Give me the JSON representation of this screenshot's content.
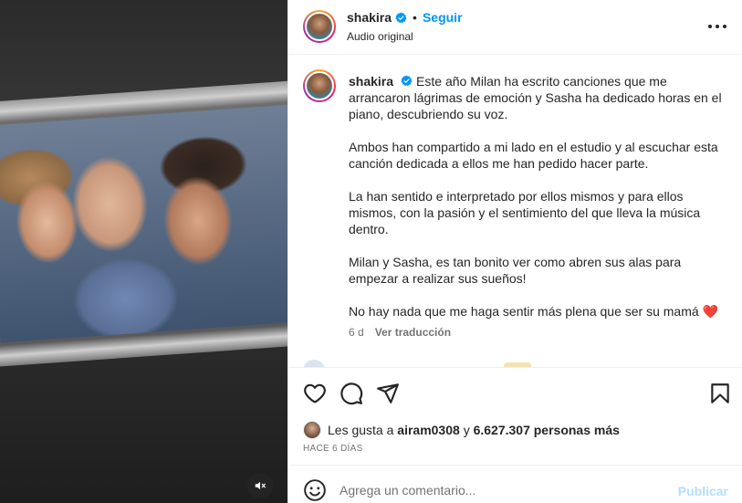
{
  "post": {
    "username": "shakira",
    "follow_label": "Seguir",
    "dot": "•",
    "audio_label": "Audio original"
  },
  "caption": {
    "username": "shakira",
    "paragraphs": [
      "Este año Milan ha escrito canciones que me arrancaron lágrimas de emoción y Sasha ha dedicado horas en el piano, descubriendo su voz.",
      "Ambos han compartido a mi lado en el estudio y al escuchar esta canción dedicada a ellos me han pedido hacer parte.",
      "La han sentido e interpretado por ellos mismos y para ellos mismos, con la pasión y el sentimiento del que lleva la música dentro.",
      "Milan y Sasha, es tan bonito ver como abren sus alas para empezar a realizar sus sueños!",
      "No hay nada que me haga sentir más plena que ser su mamá"
    ],
    "heart_emoji": "❤️",
    "age": "6 d",
    "translate_label": "Ver traducción"
  },
  "likes": {
    "prefix": "Les gusta a",
    "user": "airam0308",
    "connector": "y",
    "count": "6.627.307 personas más"
  },
  "date_label": "HACE 6 DÍAS",
  "comment": {
    "placeholder": "Agrega un comentario...",
    "publish_label": "Publicar"
  },
  "icons": [
    "verified-badge-icon",
    "more-options-icon",
    "heart-icon",
    "comment-icon",
    "share-icon",
    "bookmark-icon",
    "emoji-icon",
    "muted-speaker-icon"
  ],
  "colors": {
    "accent": "#0095f6",
    "publish_disabled": "#b2dffc",
    "heart": "#ed4956"
  }
}
